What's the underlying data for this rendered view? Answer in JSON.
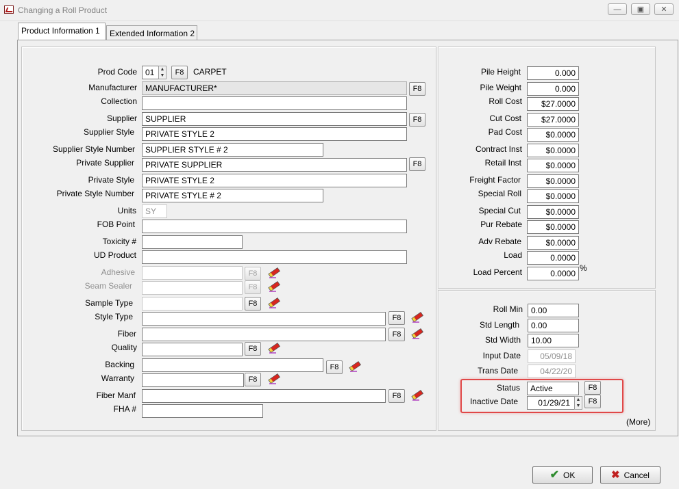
{
  "window": {
    "title": "Changing a Roll Product"
  },
  "tabs": [
    {
      "label": "Product Information 1"
    },
    {
      "label": "Extended Information 2"
    }
  ],
  "left": {
    "prod_code": {
      "label": "Prod Code",
      "value": "01",
      "f8": "F8",
      "desc": "CARPET"
    },
    "manufacturer": {
      "label": "Manufacturer",
      "value": "MANUFACTURER*",
      "f8": "F8"
    },
    "collection": {
      "label": "Collection",
      "value": ""
    },
    "supplier": {
      "label": "Supplier",
      "value": "SUPPLIER",
      "f8": "F8"
    },
    "supplier_style": {
      "label": "Supplier Style",
      "value": "PRIVATE  STYLE 2"
    },
    "supplier_style_number": {
      "label": "Supplier Style Number",
      "value": "SUPPLIER  STYLE # 2"
    },
    "private_supplier": {
      "label": "Private Supplier",
      "value": "PRIVATE SUPPLIER",
      "f8": "F8"
    },
    "private_style": {
      "label": "Private Style",
      "value": "PRIVATE  STYLE 2"
    },
    "private_style_number": {
      "label": "Private Style Number",
      "value": "PRIVATE  STYLE # 2"
    },
    "units": {
      "label": "Units",
      "value": "SY"
    },
    "fob_point": {
      "label": "FOB Point",
      "value": ""
    },
    "toxicity": {
      "label": "Toxicity #",
      "value": ""
    },
    "ud_product": {
      "label": "UD Product",
      "value": ""
    },
    "adhesive": {
      "label": "Adhesive",
      "value": "",
      "f8": "F8"
    },
    "seam_sealer": {
      "label": "Seam Sealer",
      "value": "",
      "f8": "F8"
    },
    "sample_type": {
      "label": "Sample Type",
      "value": "",
      "f8": "F8"
    },
    "style_type": {
      "label": "Style Type",
      "value": "",
      "f8": "F8"
    },
    "fiber": {
      "label": "Fiber",
      "value": "",
      "f8": "F8"
    },
    "quality": {
      "label": "Quality",
      "value": "",
      "f8": "F8"
    },
    "backing": {
      "label": "Backing",
      "value": "",
      "f8": "F8"
    },
    "warranty": {
      "label": "Warranty",
      "value": "",
      "f8": "F8"
    },
    "fiber_manf": {
      "label": "Fiber Manf",
      "value": "",
      "f8": "F8"
    },
    "fha": {
      "label": "FHA #",
      "value": ""
    }
  },
  "right_top": [
    {
      "label": "Pile Height",
      "value": "0.000"
    },
    {
      "label": "Pile Weight",
      "value": "0.000"
    },
    {
      "label": "Roll Cost",
      "value": "$27.0000"
    },
    {
      "label": "Cut Cost",
      "value": "$27.0000"
    },
    {
      "label": "Pad Cost",
      "value": "$0.0000"
    },
    {
      "label": "Contract Inst",
      "value": "$0.0000"
    },
    {
      "label": "Retail Inst",
      "value": "$0.0000"
    },
    {
      "label": "Freight Factor",
      "value": "$0.0000"
    },
    {
      "label": "Special Roll",
      "value": "$0.0000"
    },
    {
      "label": "Special Cut",
      "value": "$0.0000"
    },
    {
      "label": "Pur Rebate",
      "value": "$0.0000"
    },
    {
      "label": "Adv Rebate",
      "value": "$0.0000"
    },
    {
      "label": "Load",
      "value": "0.0000"
    },
    {
      "label": "Load Percent",
      "value": "0.0000"
    }
  ],
  "load_percent_suffix": "%",
  "right_bottom": {
    "roll_min": {
      "label": "Roll Min",
      "value": "0.00"
    },
    "std_length": {
      "label": "Std Length",
      "value": "0.00"
    },
    "std_width": {
      "label": "Std  Width",
      "value": "10.00"
    },
    "input_date": {
      "label": "Input Date",
      "value": "05/09/18"
    },
    "trans_date": {
      "label": "Trans Date",
      "value": "04/22/20"
    },
    "status": {
      "label": "Status",
      "value": "Active",
      "f8": "F8"
    },
    "inactive_date": {
      "label": "Inactive Date",
      "value": "01/29/21",
      "f8": "F8"
    },
    "more": "(More)"
  },
  "buttons": {
    "ok": "OK",
    "cancel": "Cancel"
  },
  "colors": {
    "highlight": "#e04848",
    "ok_check": "#2e8b2e",
    "cancel_x": "#c02020"
  }
}
